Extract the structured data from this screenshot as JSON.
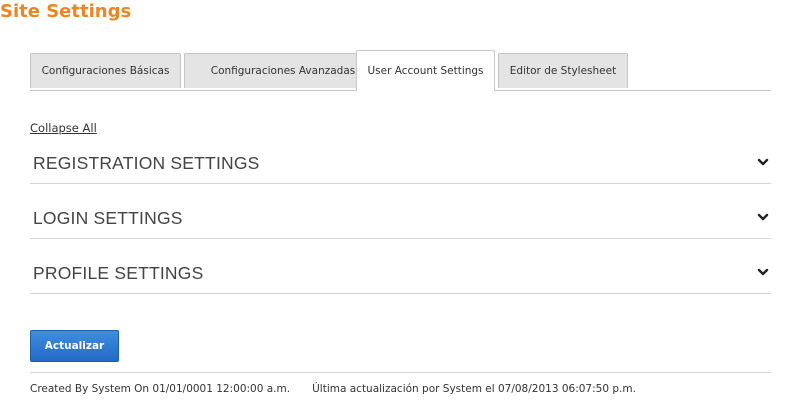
{
  "page": {
    "title": "Site Settings"
  },
  "tabs": [
    {
      "label": "Configuraciones Básicas",
      "active": false
    },
    {
      "label": "Configuraciones Avanzadas",
      "active": false
    },
    {
      "label": "User Account Settings",
      "active": true
    },
    {
      "label": "Editor de Stylesheet",
      "active": false
    }
  ],
  "collapse_all_label": "Collapse All",
  "sections": [
    {
      "title": "REGISTRATION SETTINGS",
      "icon": "chevron-down-icon"
    },
    {
      "title": "LOGIN SETTINGS",
      "icon": "chevron-down-icon"
    },
    {
      "title": "PROFILE SETTINGS",
      "icon": "chevron-down-icon"
    }
  ],
  "actions": {
    "update_label": "Actualizar"
  },
  "footer": {
    "created": "Created By System On 01/01/0001 12:00:00 a.m.",
    "modified": "Última actualización por System el 07/08/2013 06:07:50 p.m."
  },
  "colors": {
    "title": "#ee8522",
    "button": "#2a73cf",
    "tab_inactive": "#e4e4e4",
    "divider": "#d4d4d4"
  }
}
